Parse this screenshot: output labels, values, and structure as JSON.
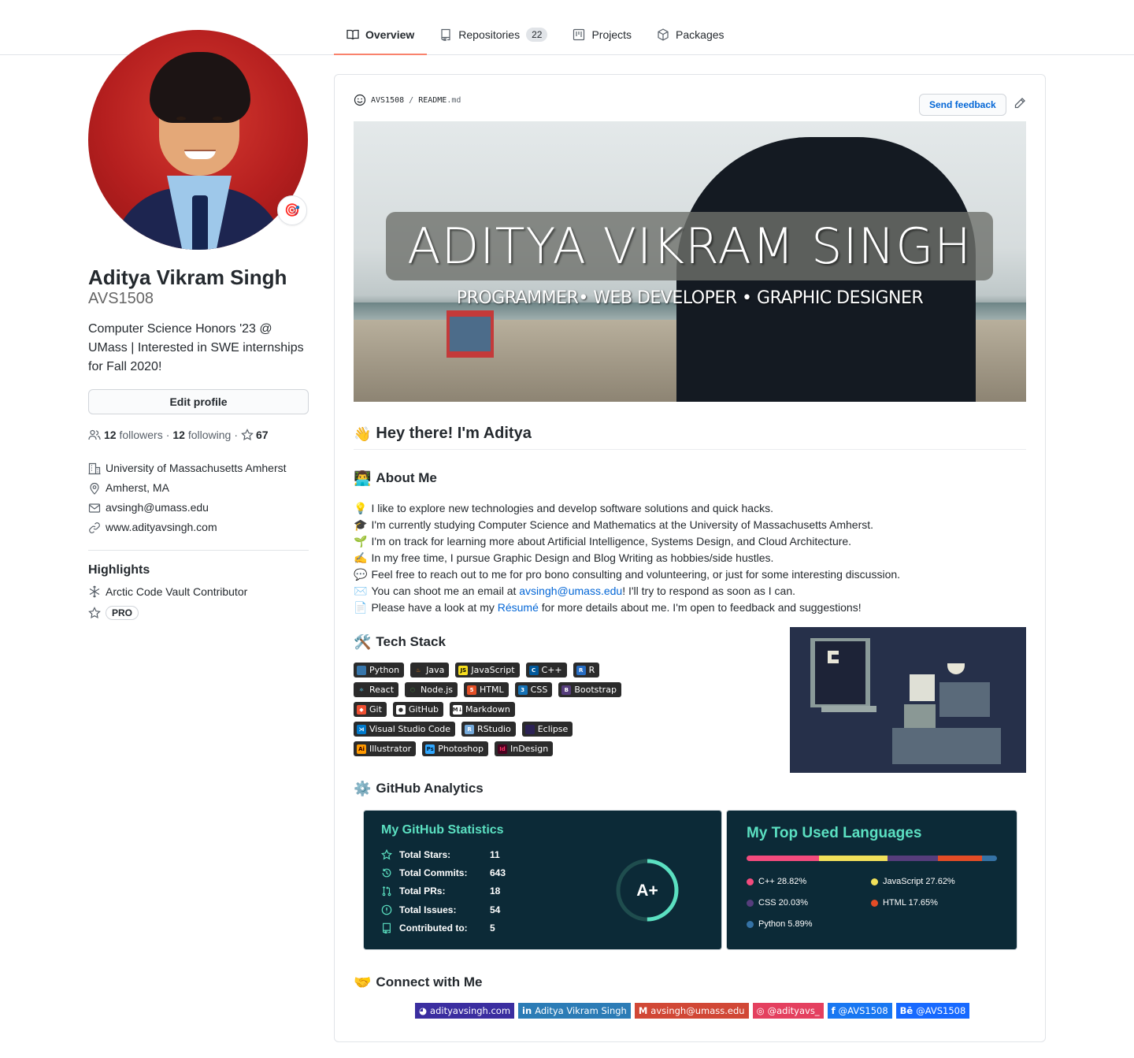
{
  "tabs": [
    {
      "label": "Overview",
      "icon": "book-icon",
      "active": true
    },
    {
      "label": "Repositories",
      "icon": "repo-icon",
      "count": "22"
    },
    {
      "label": "Projects",
      "icon": "project-icon"
    },
    {
      "label": "Packages",
      "icon": "package-icon"
    }
  ],
  "profile": {
    "fullname": "Aditya Vikram Singh",
    "username": "AVS1508",
    "status_emoji": "🎯",
    "bio": "Computer Science Honors '23 @ UMass | Interested in SWE internships for Fall 2020!",
    "edit_label": "Edit profile",
    "followers_count": "12",
    "followers_label": "followers",
    "following_count": "12",
    "following_label": "following",
    "stars": "67",
    "separator": "·",
    "organization": "University of Massachusetts Amherst",
    "location": "Amherst, MA",
    "email": "avsingh@umass.edu",
    "website": "www.adityavsingh.com"
  },
  "highlights": {
    "title": "Highlights",
    "items": [
      {
        "label": "Arctic Code Vault Contributor",
        "icon": "snowflake-icon"
      },
      {
        "label": "PRO",
        "icon": "star-icon"
      }
    ]
  },
  "readme": {
    "owner": "AVS1508",
    "slash": "/",
    "file": "README",
    "ext": ".md",
    "feedback_label": "Send feedback",
    "banner": {
      "name": "ADITYA VIKRAM SINGH",
      "roles": "PROGRAMMER• WEB DEVELOPER • GRAPHIC DESIGNER"
    },
    "greeting": {
      "emoji": "👋",
      "text": "Hey there! I'm Aditya"
    },
    "about_title": {
      "emoji": "👨‍💻",
      "text": "About Me"
    },
    "about": [
      {
        "emoji": "💡",
        "text": "I like to explore new technologies and develop software solutions and quick hacks."
      },
      {
        "emoji": "🎓",
        "text": "I'm currently studying Computer Science and Mathematics at the University of Massachusetts Amherst."
      },
      {
        "emoji": "🌱",
        "text": "I'm on track for learning more about Artificial Intelligence, Systems Design, and Cloud Architecture."
      },
      {
        "emoji": "✍️",
        "text": "In my free time, I pursue Graphic Design and Blog Writing as hobbies/side hustles."
      },
      {
        "emoji": "💬",
        "text": "Feel free to reach out to me for pro bono consulting and volunteering, or just for some interesting discussion."
      },
      {
        "emoji": "✉️",
        "pre": "You can shoot me an email at ",
        "link": "avsingh@umass.edu",
        "post": "! I'll try to respond as soon as I can."
      },
      {
        "emoji": "📄",
        "pre": "Please have a look at my ",
        "link": "Résumé",
        "post": " for more details about me. I'm open to feedback and suggestions!"
      }
    ],
    "tech_title": {
      "emoji": "🛠️",
      "text": "Tech Stack"
    },
    "tech_rows": [
      [
        {
          "label": "Python",
          "icon_bg": "#3776ab",
          "icon_text": "",
          "icon_color": "#ffd43b"
        },
        {
          "label": "Java",
          "icon_bg": "#2b2b2b",
          "icon_text": "♨",
          "icon_color": "#e07b1c"
        },
        {
          "label": "JavaScript",
          "icon_bg": "#f7df1e",
          "icon_text": "JS",
          "icon_color": "#000"
        },
        {
          "label": "C++",
          "icon_bg": "#00599c",
          "icon_text": "C",
          "icon_color": "#fff"
        },
        {
          "label": "R",
          "icon_bg": "#276dc3",
          "icon_text": "R",
          "icon_color": "#fff"
        }
      ],
      [
        {
          "label": "React",
          "icon_bg": "#2b2b2b",
          "icon_text": "⚛",
          "icon_color": "#61dafb"
        },
        {
          "label": "Node.js",
          "icon_bg": "#2b2b2b",
          "icon_text": "⬡",
          "icon_color": "#43853d"
        },
        {
          "label": "HTML",
          "icon_bg": "#e34f26",
          "icon_text": "5",
          "icon_color": "#fff"
        },
        {
          "label": "CSS",
          "icon_bg": "#1572b6",
          "icon_text": "3",
          "icon_color": "#fff"
        },
        {
          "label": "Bootstrap",
          "icon_bg": "#563d7c",
          "icon_text": "B",
          "icon_color": "#fff"
        }
      ],
      [
        {
          "label": "Git",
          "icon_bg": "#f05032",
          "icon_text": "◆",
          "icon_color": "#fff"
        },
        {
          "label": "GitHub",
          "icon_bg": "#fff",
          "icon_text": "●",
          "icon_color": "#2b2b2b"
        },
        {
          "label": "Markdown",
          "icon_bg": "#fff",
          "icon_text": "M↓",
          "icon_color": "#2b2b2b"
        }
      ],
      [
        {
          "label": "Visual Studio Code",
          "icon_bg": "#007acc",
          "icon_text": "⋊",
          "icon_color": "#fff"
        },
        {
          "label": "RStudio",
          "icon_bg": "#75aadb",
          "icon_text": "R",
          "icon_color": "#fff"
        },
        {
          "label": "Eclipse",
          "icon_bg": "#2c2255",
          "icon_text": "",
          "icon_color": "#fff"
        }
      ],
      [
        {
          "label": "Illustrator",
          "icon_bg": "#ff9a00",
          "icon_text": "Ai",
          "icon_color": "#330000"
        },
        {
          "label": "Photoshop",
          "icon_bg": "#31a8ff",
          "icon_text": "Ps",
          "icon_color": "#001e36"
        },
        {
          "label": "InDesign",
          "icon_bg": "#49021f",
          "icon_text": "Id",
          "icon_color": "#ff3366"
        }
      ]
    ],
    "analytics_title": {
      "emoji": "⚙️",
      "text": "GitHub Analytics"
    },
    "stats_card": {
      "title": "My GitHub Statistics",
      "rows": [
        {
          "label": "Total Stars:",
          "value": "11",
          "icon": "star-icon"
        },
        {
          "label": "Total Commits:",
          "value": "643",
          "icon": "history-icon"
        },
        {
          "label": "Total PRs:",
          "value": "18",
          "icon": "pull-request-icon"
        },
        {
          "label": "Total Issues:",
          "value": "54",
          "icon": "issue-icon"
        },
        {
          "label": "Contributed to:",
          "value": "5",
          "icon": "repo-icon"
        }
      ],
      "grade": "A+",
      "grade_progress": 0.5
    },
    "langs_card": {
      "title": "My Top Used Languages",
      "languages": [
        {
          "name": "C++",
          "percent": 28.82,
          "label": "C++ 28.82%",
          "color": "#f34b7d"
        },
        {
          "name": "JavaScript",
          "percent": 27.62,
          "label": "JavaScript 27.62%",
          "color": "#f1e05a"
        },
        {
          "name": "CSS",
          "percent": 20.03,
          "label": "CSS 20.03%",
          "color": "#563d7c"
        },
        {
          "name": "HTML",
          "percent": 17.65,
          "label": "HTML 17.65%",
          "color": "#e34c26"
        },
        {
          "name": "Python",
          "percent": 5.89,
          "label": "Python 5.89%",
          "color": "#3572a5"
        }
      ]
    },
    "connect_title": {
      "emoji": "🤝",
      "text": "Connect with Me"
    },
    "connect": [
      {
        "label": "adityavsingh.com",
        "bg": "#3b2ea0",
        "icon": "◕",
        "name": "website-badge"
      },
      {
        "label": "Aditya Vikram Singh",
        "bg": "#2c7cb6",
        "icon": "in",
        "name": "linkedin-badge"
      },
      {
        "label": "avsingh@umass.edu",
        "bg": "#d14836",
        "icon": "M",
        "name": "gmail-badge"
      },
      {
        "label": "@adityavs_",
        "bg": "#e4405f",
        "icon": "◎",
        "name": "instagram-badge"
      },
      {
        "label": "@AVS1508",
        "bg": "#1877f2",
        "icon": "f",
        "name": "facebook-badge"
      },
      {
        "label": "@AVS1508",
        "bg": "#1769ff",
        "icon": "Bē",
        "name": "behance-badge"
      }
    ]
  },
  "colors": {
    "accent_tab_underline": "#f9826c",
    "link": "#0366d6",
    "card_bg": "#0c2a37",
    "card_title": "#5be0c1"
  }
}
